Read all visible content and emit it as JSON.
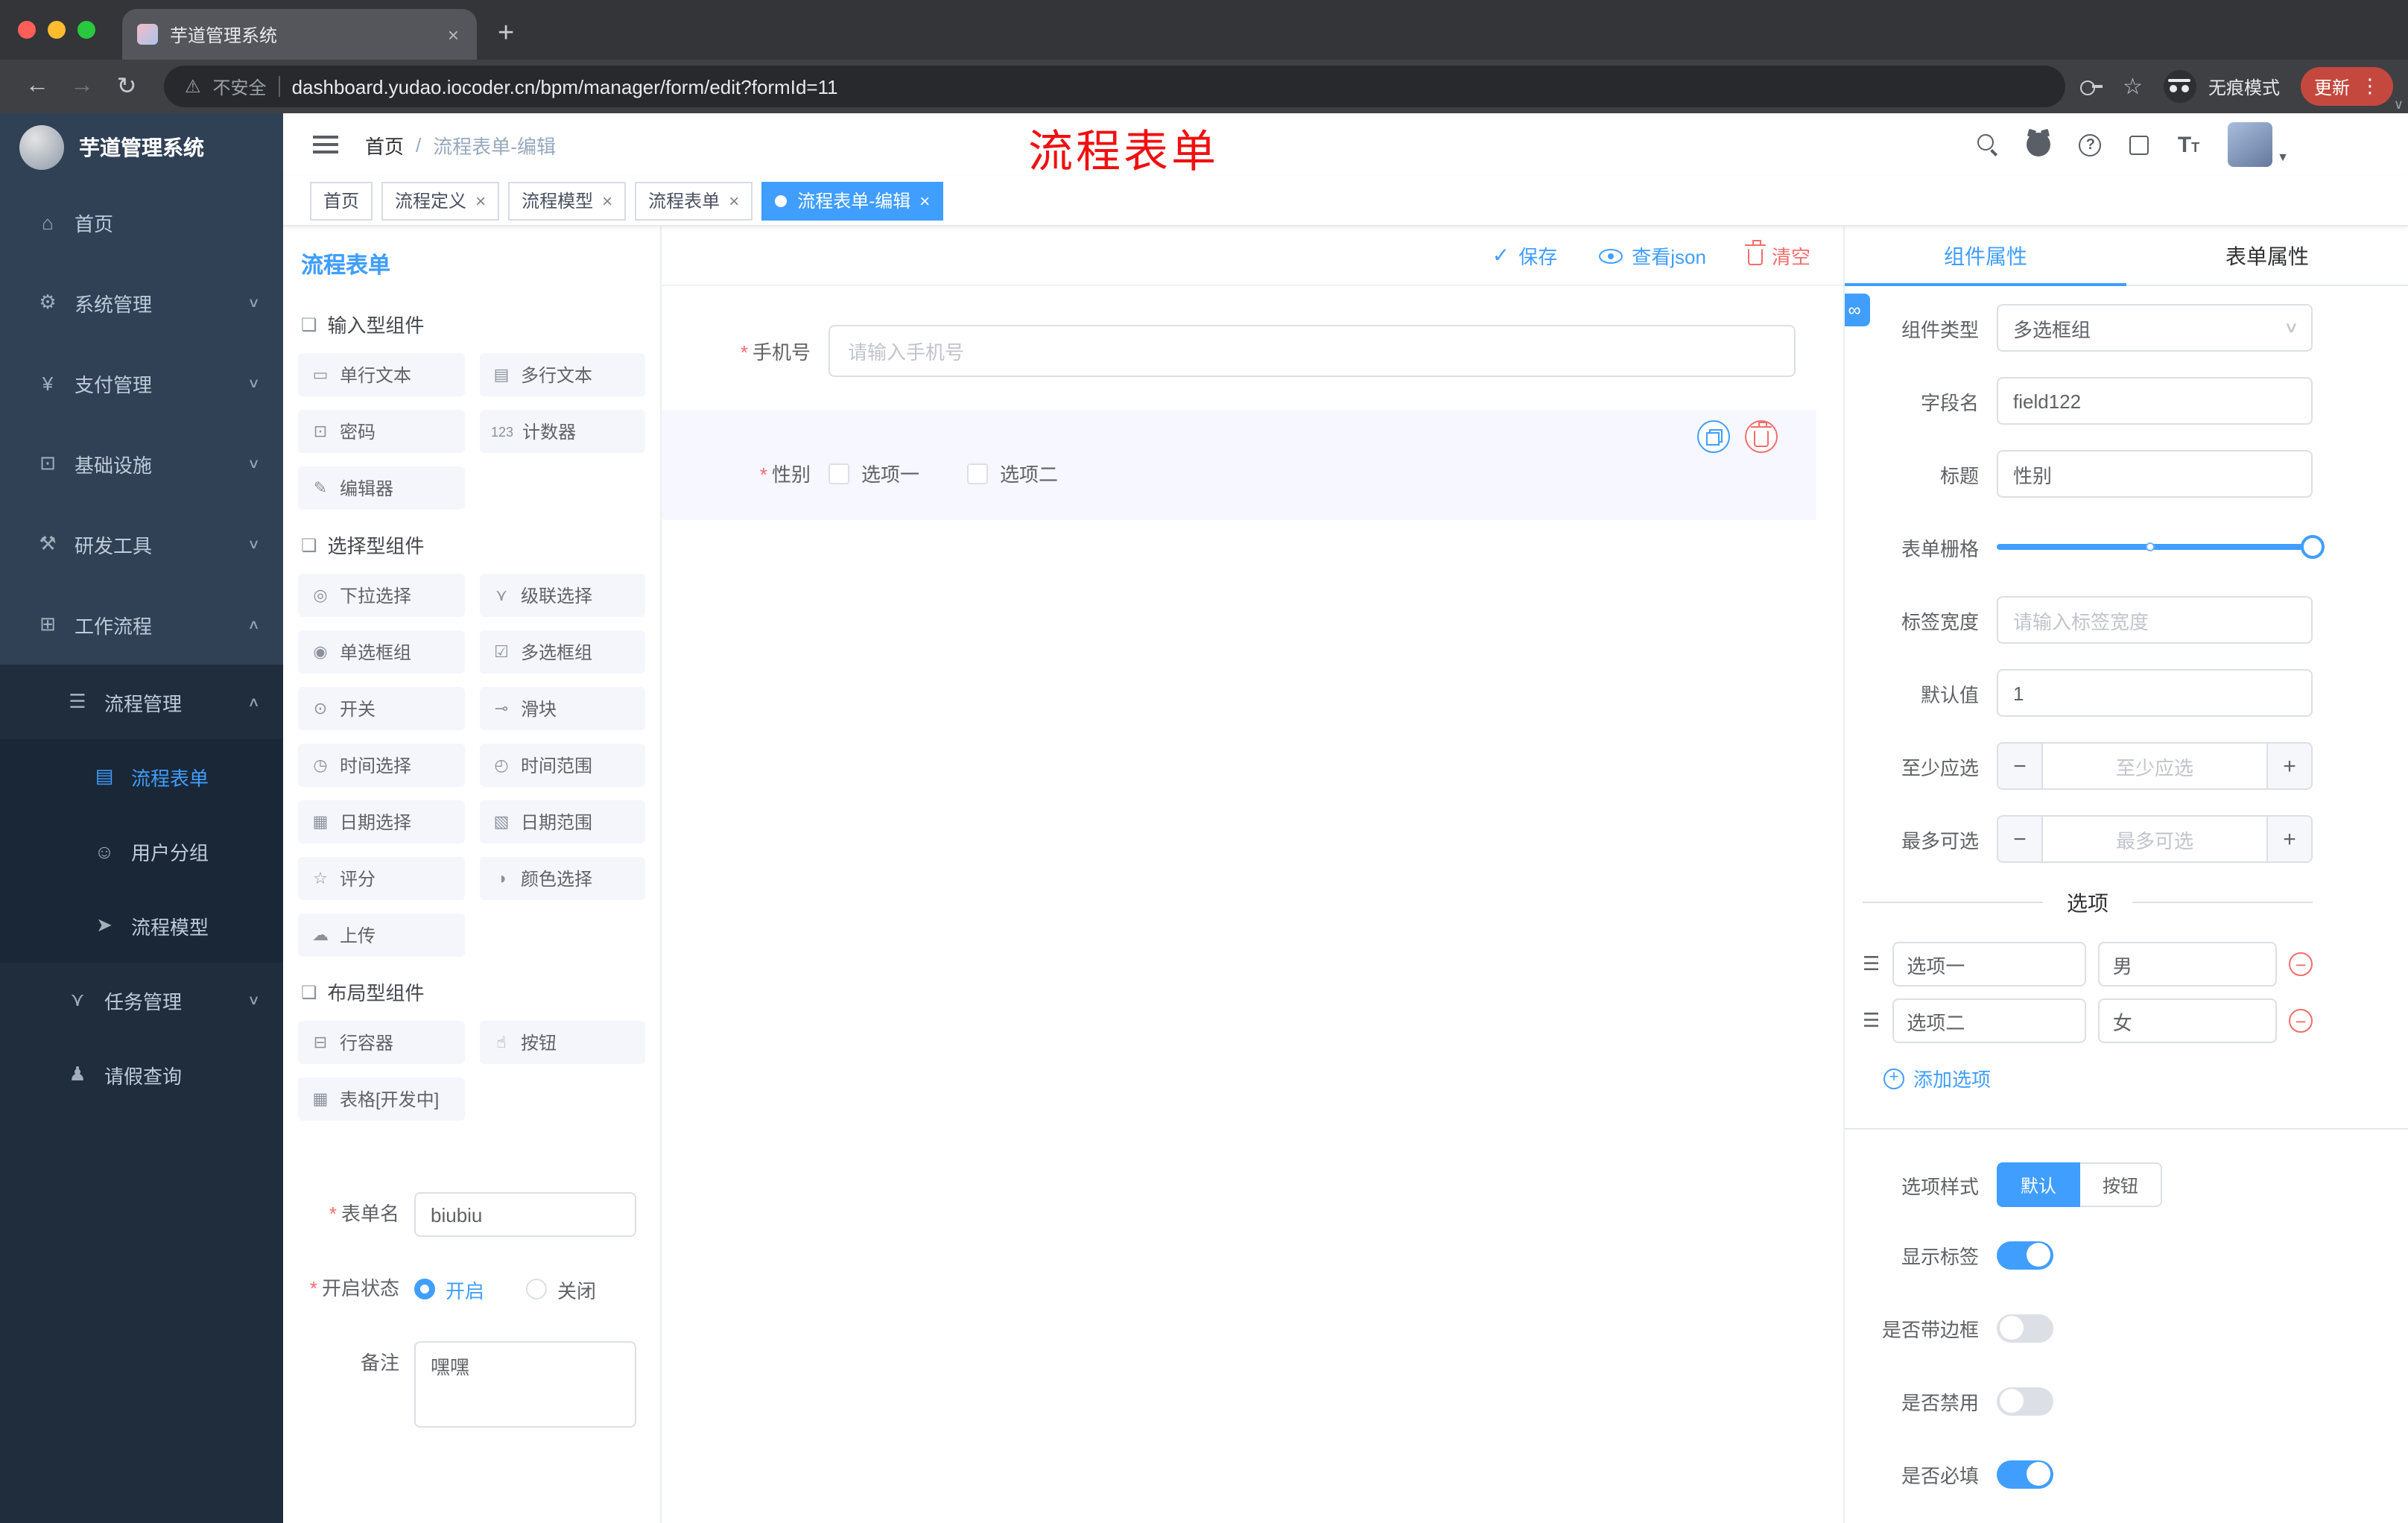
{
  "colors": {
    "accent": "#409eff",
    "danger": "#f56c6c",
    "annotation_red": "#f01010",
    "tag_active": "#409eff"
  },
  "browser": {
    "tab_title": "芋道管理系统",
    "security_label": "不安全",
    "url": "dashboard.yudao.iocoder.cn/bpm/manager/form/edit?formId=11",
    "incognito_label": "无痕模式",
    "update_label": "更新"
  },
  "sidebar": {
    "logo_title": "芋道管理系统",
    "chevron_up": "∧",
    "chevron_down": "∨",
    "menu": [
      {
        "label": "首页",
        "icon": "⌂"
      },
      {
        "label": "系统管理",
        "icon": "⚙"
      },
      {
        "label": "支付管理",
        "icon": "¥"
      },
      {
        "label": "基础设施",
        "icon": "⊡"
      },
      {
        "label": "研发工具",
        "icon": "⚒"
      },
      {
        "label": "工作流程",
        "icon": "⊞"
      },
      {
        "label": "流程管理",
        "icon": "☰"
      },
      {
        "label": "流程表单",
        "icon": "▤"
      },
      {
        "label": "用户分组",
        "icon": "☺"
      },
      {
        "label": "流程模型",
        "icon": "➤"
      },
      {
        "label": "任务管理",
        "icon": "⋎"
      },
      {
        "label": "请假查询",
        "icon": "♟"
      }
    ]
  },
  "navbar": {
    "breadcrumb_home": "首页",
    "breadcrumb_sep": "/",
    "breadcrumb_current": "流程表单-编辑"
  },
  "annotation": "流程表单",
  "tags": [
    {
      "label": "首页"
    },
    {
      "label": "流程定义"
    },
    {
      "label": "流程模型"
    },
    {
      "label": "流程表单"
    },
    {
      "label": "流程表单-编辑"
    }
  ],
  "designer": {
    "panel_title": "流程表单",
    "group_icon": "❏",
    "toolbar": {
      "save": "保存",
      "view_json": "查看json",
      "clear": "清空"
    },
    "groups": [
      {
        "title": "输入型组件",
        "items": [
          {
            "label": "单行文本",
            "icon": "▭"
          },
          {
            "label": "多行文本",
            "icon": "▤"
          },
          {
            "label": "密码",
            "icon": "⊡"
          },
          {
            "label": "计数器",
            "icon": "123"
          },
          {
            "label": "编辑器",
            "icon": "✎"
          }
        ]
      },
      {
        "title": "选择型组件",
        "items": [
          {
            "label": "下拉选择",
            "icon": "◎"
          },
          {
            "label": "级联选择",
            "icon": "⋎"
          },
          {
            "label": "单选框组",
            "icon": "◉"
          },
          {
            "label": "多选框组",
            "icon": "☑"
          },
          {
            "label": "开关",
            "icon": "⊙"
          },
          {
            "label": "滑块",
            "icon": "⊸"
          },
          {
            "label": "时间选择",
            "icon": "◷"
          },
          {
            "label": "时间范围",
            "icon": "◴"
          },
          {
            "label": "日期选择",
            "icon": "▦"
          },
          {
            "label": "日期范围",
            "icon": "▧"
          },
          {
            "label": "评分",
            "icon": "☆"
          },
          {
            "label": "颜色选择",
            "icon": "◑"
          },
          {
            "label": "上传",
            "icon": "☁"
          }
        ]
      },
      {
        "title": "布局型组件",
        "items": [
          {
            "label": "行容器",
            "icon": "⊟"
          },
          {
            "label": "按钮",
            "icon": "☝"
          },
          {
            "label": "表格[开发中]",
            "icon": "▦"
          }
        ]
      }
    ],
    "form": {
      "name_label": "表单名",
      "name_value": "biubiu",
      "status_label": "开启状态",
      "status_on": "开启",
      "status_off": "关闭",
      "remark_label": "备注",
      "remark_value": "嘿嘿"
    },
    "canvas": {
      "phone_label": "手机号",
      "phone_placeholder": "请输入手机号",
      "gender_label": "性别",
      "gender_opt1": "选项一",
      "gender_opt2": "选项二"
    }
  },
  "props": {
    "tab_component": "组件属性",
    "tab_form": "表单属性",
    "type_label": "组件类型",
    "type_value": "多选框组",
    "field_label": "字段名",
    "field_value": "field122",
    "title_label": "标题",
    "title_value": "性别",
    "grid_label": "表单栅格",
    "label_width_label": "标签宽度",
    "label_width_placeholder": "请输入标签宽度",
    "default_label": "默认值",
    "default_value": "1",
    "min_label": "至少应选",
    "min_placeholder": "至少应选",
    "max_label": "最多可选",
    "max_placeholder": "最多可选",
    "options_divider": "选项",
    "options": [
      {
        "name": "选项一",
        "value": "男"
      },
      {
        "name": "选项二",
        "value": "女"
      }
    ],
    "add_option": "添加选项",
    "style_label": "选项样式",
    "style_default": "默认",
    "style_button": "按钮",
    "switch_show_label": "显示标签",
    "switch_border": "是否带边框",
    "switch_disabled": "是否禁用",
    "switch_required": "是否必填"
  }
}
